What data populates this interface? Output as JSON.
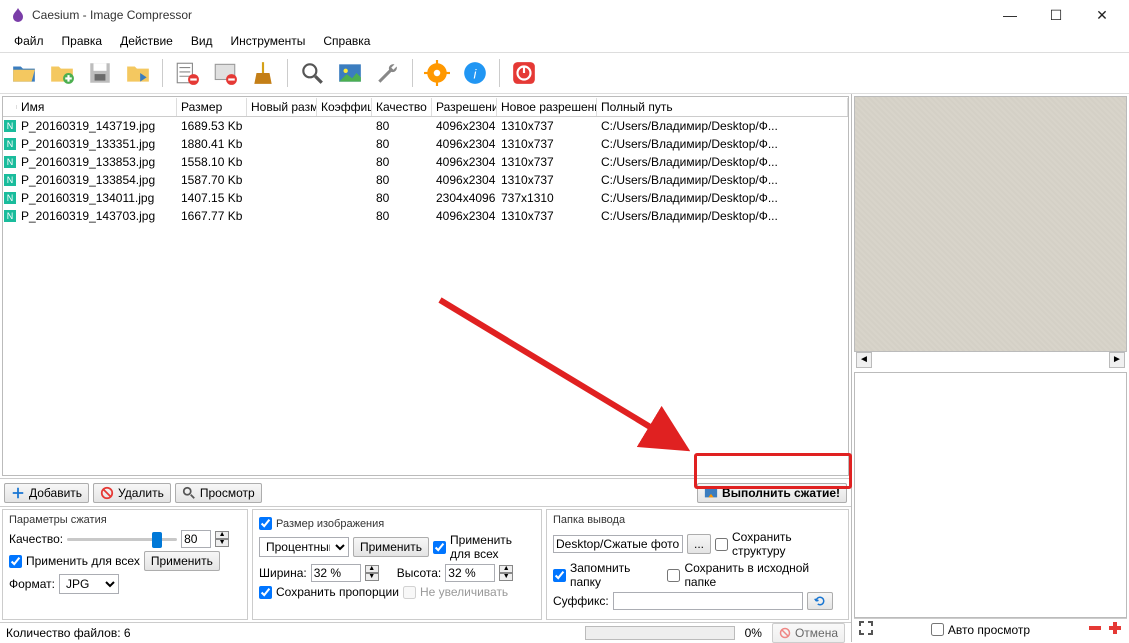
{
  "window": {
    "title": "Caesium - Image Compressor"
  },
  "menu": [
    "Файл",
    "Правка",
    "Действие",
    "Вид",
    "Инструменты",
    "Справка"
  ],
  "toolbar_icons": [
    "open-folder",
    "add-folder",
    "save",
    "folder-out",
    "remove-list",
    "remove-folder",
    "clean",
    "magnifier",
    "preview-image",
    "tools",
    "settings-gear",
    "info",
    "power"
  ],
  "columns": {
    "name": "Имя",
    "size": "Размер",
    "newsize": "Новый разм",
    "coef": "Коэффици",
    "qual": "Качество",
    "res": "Разрешение",
    "newres": "Новое разрешение",
    "path": "Полный путь"
  },
  "rows": [
    {
      "name": "P_20160319_143719.jpg",
      "size": "1689.53 Kb",
      "newsize": "",
      "coef": "",
      "qual": "80",
      "res": "4096x2304",
      "newres": "1310x737",
      "path": "C:/Users/Владимир/Desktop/Ф..."
    },
    {
      "name": "P_20160319_133351.jpg",
      "size": "1880.41 Kb",
      "newsize": "",
      "coef": "",
      "qual": "80",
      "res": "4096x2304",
      "newres": "1310x737",
      "path": "C:/Users/Владимир/Desktop/Ф..."
    },
    {
      "name": "P_20160319_133853.jpg",
      "size": "1558.10 Kb",
      "newsize": "",
      "coef": "",
      "qual": "80",
      "res": "4096x2304",
      "newres": "1310x737",
      "path": "C:/Users/Владимир/Desktop/Ф..."
    },
    {
      "name": "P_20160319_133854.jpg",
      "size": "1587.70 Kb",
      "newsize": "",
      "coef": "",
      "qual": "80",
      "res": "4096x2304",
      "newres": "1310x737",
      "path": "C:/Users/Владимир/Desktop/Ф..."
    },
    {
      "name": "P_20160319_134011.jpg",
      "size": "1407.15 Kb",
      "newsize": "",
      "coef": "",
      "qual": "80",
      "res": "2304x4096",
      "newres": "737x1310",
      "path": "C:/Users/Владимир/Desktop/Ф..."
    },
    {
      "name": "P_20160319_143703.jpg",
      "size": "1667.77 Kb",
      "newsize": "",
      "coef": "",
      "qual": "80",
      "res": "4096x2304",
      "newres": "1310x737",
      "path": "C:/Users/Владимир/Desktop/Ф..."
    }
  ],
  "midbar": {
    "add": "Добавить",
    "remove": "Удалить",
    "preview": "Просмотр",
    "compress": "Выполнить сжатие!"
  },
  "g1": {
    "title": "Параметры сжатия",
    "quality": "Качество:",
    "qval": "80",
    "applyall": "Применить для всех",
    "apply": "Применить",
    "format": "Формат:",
    "formatval": "JPG"
  },
  "g2": {
    "title": "Размер изображения",
    "mode": "Процентный",
    "apply": "Применить",
    "applyall": "Применить для всех",
    "width": "Ширина:",
    "wval": "32 %",
    "height": "Высота:",
    "hval": "32 %",
    "keep": "Сохранить пропорции",
    "noenl": "Не увеличивать"
  },
  "g3": {
    "title": "Папка вывода",
    "path": "Desktop/Сжатые фото",
    "keeptree": "Сохранить структуру",
    "remember": "Запомнить папку",
    "sameout": "Сохранить в исходной папке",
    "suffix": "Суффикс:",
    "suffixval": ""
  },
  "status": {
    "count": "Количество файлов: 6",
    "pct": "0%",
    "cancel": "Отмена"
  },
  "right": {
    "auto": "Авто просмотр"
  }
}
